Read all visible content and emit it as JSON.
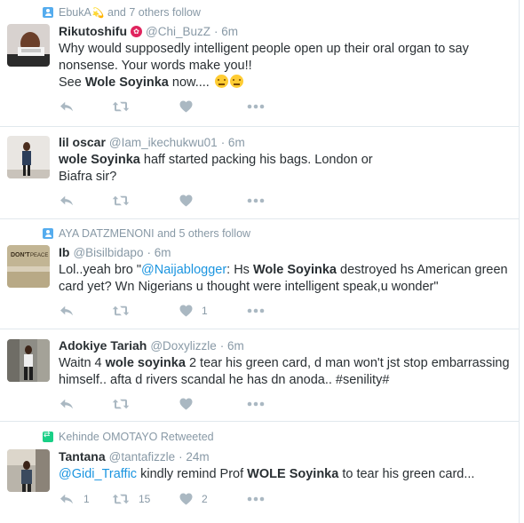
{
  "tweets": [
    {
      "context": "EbukA",
      "context_emoji": "💫",
      "context_rest": " and 7 others follow",
      "context_type": "follow",
      "name": "Rikutoshifu",
      "badge": "✿",
      "handle": "@Chi_BuzZ",
      "time": "· 6m",
      "line1": "Why would supposedly intelligent people open up their oral organ to say",
      "line2": "nonsense. Your words make you!!",
      "line3_pre": "See ",
      "line3_bold": "Wole Soyinka",
      "line3_post": " now....",
      "retweets": "",
      "likes": ""
    },
    {
      "name": "lil oscar",
      "handle": "@Iam_ikechukwu01",
      "time": "· 6m",
      "bold1": "wole Soyinka",
      "line1_post": " haff started packing his bags. London or",
      "line2": "Biafra sir?"
    },
    {
      "context": "AYA DATZMENONI and 5 others follow",
      "context_type": "follow",
      "name": "Ib",
      "handle": "@Bisilbidapo",
      "time": "· 6m",
      "line1_pre": "Lol..yeah bro \"",
      "link": "@Naijablogger",
      "line1_mid": ": Hs ",
      "bold": "Wole Soyinka",
      "line1_post": " destroyed hs American green",
      "line2": "card yet? Wn Nigerians u thought were intelligent speak,u wonder\"",
      "likes": "1"
    },
    {
      "name": "Adokiye Tariah",
      "handle": "@Doxylizzle",
      "time": "· 6m",
      "line1_pre": "Waitn 4 ",
      "bold": "wole soyinka",
      "line1_post": " 2 tear his green card, d man won't jst stop embarrassing",
      "line2": "himself.. afta d rivers scandal he has dn anoda.. #senility#"
    },
    {
      "context": "Kehinde OMOTAYO Retweeted",
      "context_type": "retweet",
      "name": "Tantana",
      "handle": "@tantafizzle",
      "time": "· 24m",
      "link": "@Gidi_Traffic",
      "line1_mid": " kindly remind Prof ",
      "bold": "WOLE Soyinka",
      "line1_post": " to tear his green card...",
      "replies": "1",
      "retweets": "15",
      "likes": "2"
    }
  ],
  "colors": {
    "accent": "#1b95e0",
    "muted": "#8899a6",
    "text": "#292f33",
    "follow_icon": "#55acee",
    "retweet_icon": "#19cf86",
    "badge": "#e0245e"
  },
  "icons": [
    "reply-icon",
    "retweet-icon",
    "like-icon",
    "more-icon",
    "follow-context-icon",
    "retweet-context-icon"
  ]
}
